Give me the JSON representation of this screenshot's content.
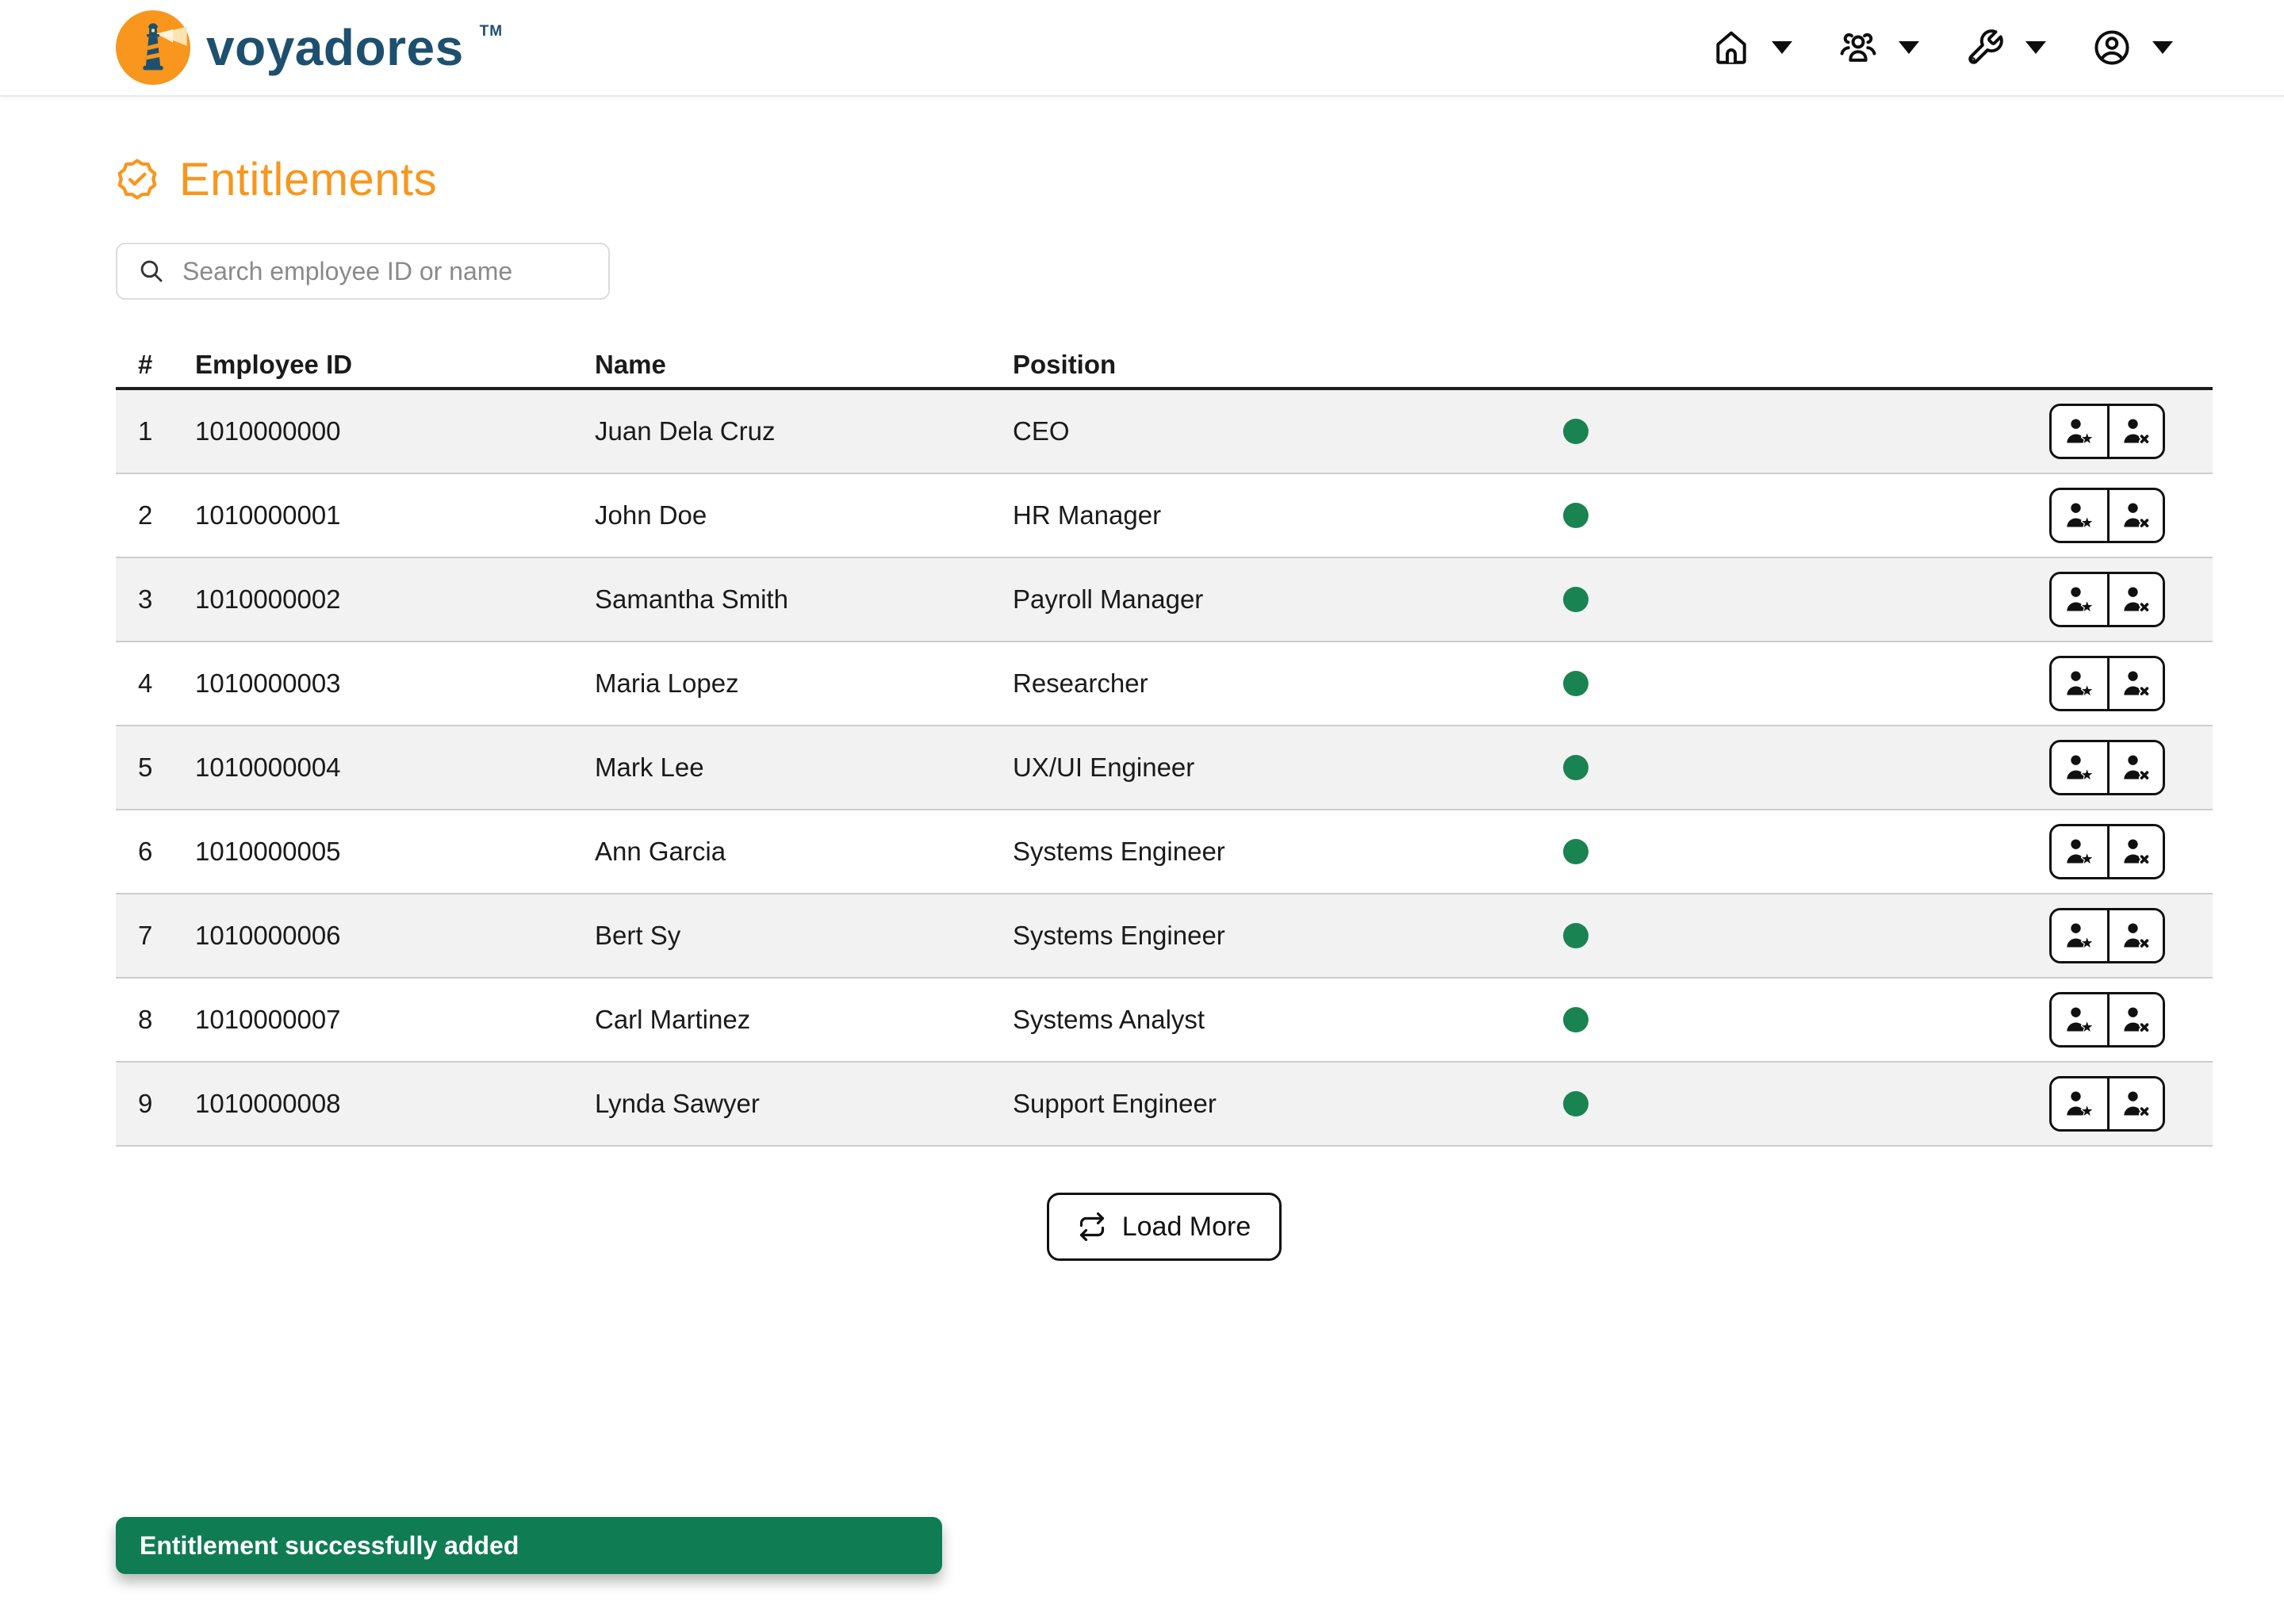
{
  "header": {
    "brand": "voyadores",
    "trademark": "TM",
    "nav": [
      {
        "id": "home",
        "icon": "home-icon"
      },
      {
        "id": "users",
        "icon": "users-icon"
      },
      {
        "id": "tools",
        "icon": "wrench-icon"
      },
      {
        "id": "account",
        "icon": "account-icon"
      }
    ]
  },
  "page": {
    "title": "Entitlements"
  },
  "search": {
    "placeholder": "Search employee ID or name"
  },
  "table": {
    "headers": {
      "index": "#",
      "employee_id": "Employee ID",
      "name": "Name",
      "position": "Position"
    },
    "rows": [
      {
        "index": "1",
        "employee_id": "1010000000",
        "name": "Juan Dela Cruz",
        "position": "CEO",
        "status": "active"
      },
      {
        "index": "2",
        "employee_id": "1010000001",
        "name": "John Doe",
        "position": "HR Manager",
        "status": "active"
      },
      {
        "index": "3",
        "employee_id": "1010000002",
        "name": "Samantha Smith",
        "position": "Payroll Manager",
        "status": "active"
      },
      {
        "index": "4",
        "employee_id": "1010000003",
        "name": "Maria Lopez",
        "position": "Researcher",
        "status": "active"
      },
      {
        "index": "5",
        "employee_id": "1010000004",
        "name": "Mark Lee",
        "position": "UX/UI Engineer",
        "status": "active"
      },
      {
        "index": "6",
        "employee_id": "1010000005",
        "name": "Ann Garcia",
        "position": "Systems Engineer",
        "status": "active"
      },
      {
        "index": "7",
        "employee_id": "1010000006",
        "name": "Bert Sy",
        "position": "Systems Engineer",
        "status": "active"
      },
      {
        "index": "8",
        "employee_id": "1010000007",
        "name": "Carl Martinez",
        "position": "Systems Analyst",
        "status": "active"
      },
      {
        "index": "9",
        "employee_id": "1010000008",
        "name": "Lynda Sawyer",
        "position": "Support Engineer",
        "status": "active"
      }
    ]
  },
  "load_more": {
    "label": "Load More"
  },
  "toast": {
    "message": "Entitlement successfully added"
  },
  "colors": {
    "accent_orange": "#F8961D",
    "brand_navy": "#1D506E",
    "status_green": "#1A8352",
    "toast_green": "#0F7C54",
    "row_stripe": "#F2F2F2"
  }
}
